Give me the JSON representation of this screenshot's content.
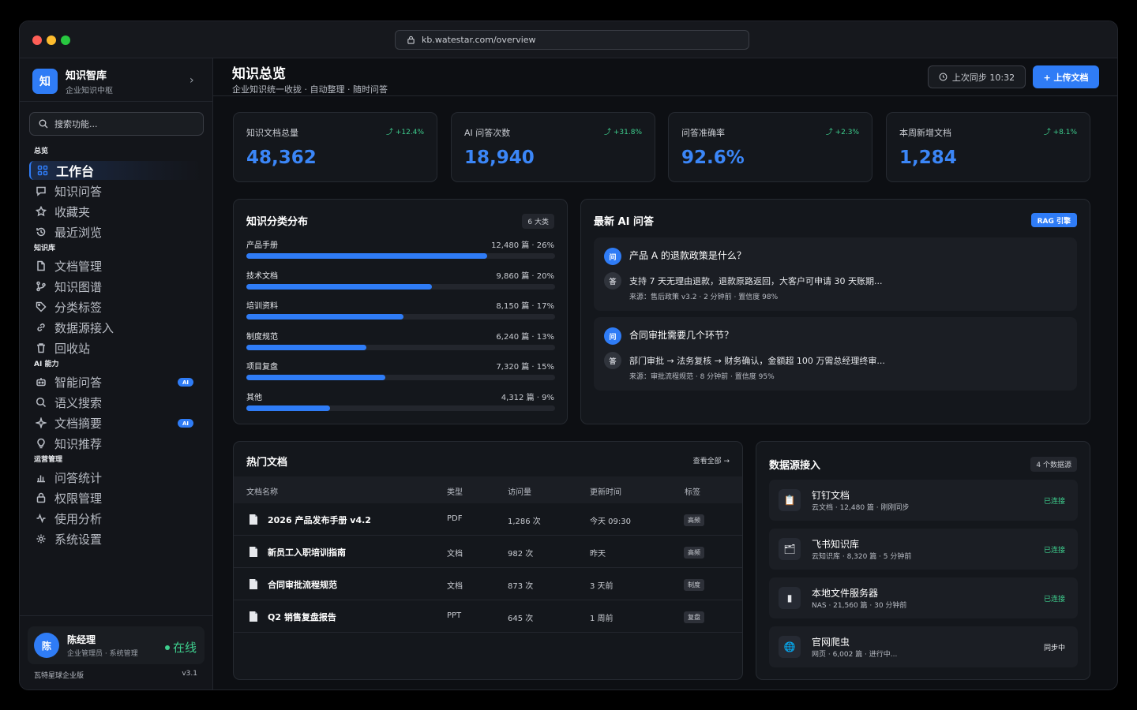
{
  "browser": {
    "url": "kb.watestar.com/overview"
  },
  "brand": {
    "logo": "知",
    "title": "知识智库",
    "subtitle": "企业知识中枢"
  },
  "search": {
    "placeholder": "搜索功能..."
  },
  "sections": {
    "overview": "总览",
    "kb": "知识库",
    "ai": "AI 能力",
    "ops": "运营管理"
  },
  "nav": [
    {
      "label": "工作台",
      "icon": "grid-icon"
    },
    {
      "label": "知识问答",
      "icon": "chat-icon"
    },
    {
      "label": "收藏夹",
      "icon": "star-icon"
    },
    {
      "label": "最近浏览",
      "icon": "history-icon"
    },
    {
      "label": "文档管理",
      "icon": "file-icon"
    },
    {
      "label": "知识图谱",
      "icon": "graph-icon"
    },
    {
      "label": "分类标签",
      "icon": "tag-icon"
    },
    {
      "label": "数据源接入",
      "icon": "link-icon"
    },
    {
      "label": "回收站",
      "icon": "trash-icon"
    },
    {
      "label": "智能问答",
      "icon": "robot-icon",
      "badge": "AI"
    },
    {
      "label": "语义搜索",
      "icon": "search-icon"
    },
    {
      "label": "文档摘要",
      "icon": "sparkle-icon",
      "badge": "AI"
    },
    {
      "label": "知识推荐",
      "icon": "bulb-icon"
    },
    {
      "label": "问答统计",
      "icon": "bar-chart-icon"
    },
    {
      "label": "权限管理",
      "icon": "lock-icon"
    },
    {
      "label": "使用分析",
      "icon": "activity-icon"
    },
    {
      "label": "系统设置",
      "icon": "gear-icon"
    }
  ],
  "user": {
    "avatar": "陈",
    "name": "陈经理",
    "role": "企业管理员 · 系统管理",
    "status": "在线"
  },
  "footer": {
    "edition": "瓦特星球企业版",
    "version": "v3.1"
  },
  "header": {
    "title": "知识总览",
    "subtitle": "企业知识统一收拢 · 自动整理 · 随时问答",
    "sync": "上次同步 10:32",
    "upload": "+ 上传文档"
  },
  "stats": [
    {
      "label": "知识文档总量",
      "delta": "+12.4%",
      "value": "48,362"
    },
    {
      "label": "AI 问答次数",
      "delta": "+31.8%",
      "value": "18,940"
    },
    {
      "label": "问答准确率",
      "delta": "+2.3%",
      "value": "92.6%"
    },
    {
      "label": "本周新增文档",
      "delta": "+8.1%",
      "value": "1,284"
    }
  ],
  "categories": {
    "title": "知识分类分布",
    "badge": "6 大类",
    "items": [
      {
        "name": "产品手册",
        "value": "12,480 篇 · 26%",
        "fraction": 0.78
      },
      {
        "name": "技术文档",
        "value": "9,860 篇 · 20%",
        "fraction": 0.6
      },
      {
        "name": "培训资料",
        "value": "8,150 篇 · 17%",
        "fraction": 0.51
      },
      {
        "name": "制度规范",
        "value": "6,240 篇 · 13%",
        "fraction": 0.39
      },
      {
        "name": "项目复盘",
        "value": "7,320 篇 · 15%",
        "fraction": 0.45
      },
      {
        "name": "其他",
        "value": "4,312 篇 · 9%",
        "fraction": 0.27
      }
    ]
  },
  "qa": {
    "title": "最新 AI 问答",
    "badge": "RAG 引擎",
    "q_label": "问",
    "a_label": "答",
    "items": [
      {
        "q": "产品 A 的退款政策是什么？",
        "a": "支持 7 天无理由退款，退款原路返回，大客户可申请 30 天账期...",
        "src": "来源：售后政策 v3.2 · 2 分钟前 · 置信度 98%"
      },
      {
        "q": "合同审批需要几个环节？",
        "a": "部门审批 → 法务复核 → 财务确认，金额超 100 万需总经理终审...",
        "src": "来源：审批流程规范 · 8 分钟前 · 置信度 95%"
      }
    ]
  },
  "docs": {
    "title": "热门文档",
    "view_all": "查看全部 →",
    "columns": [
      "文档名称",
      "类型",
      "访问量",
      "更新时间",
      "标签"
    ],
    "rows": [
      {
        "name": "2026 产品发布手册 v4.2",
        "type": "PDF",
        "views": "1,286 次",
        "updated": "今天 09:30",
        "tag": "高频"
      },
      {
        "name": "新员工入职培训指南",
        "type": "文档",
        "views": "982 次",
        "updated": "昨天",
        "tag": "高频"
      },
      {
        "name": "合同审批流程规范",
        "type": "文档",
        "views": "873 次",
        "updated": "3 天前",
        "tag": "制度"
      },
      {
        "name": "Q2 销售复盘报告",
        "type": "PPT",
        "views": "645 次",
        "updated": "1 周前",
        "tag": "复盘"
      }
    ]
  },
  "sources": {
    "title": "数据源接入",
    "badge": "4 个数据源",
    "items": [
      {
        "name": "钉钉文档",
        "meta": "云文档 · 12,480 篇 · 刚刚同步",
        "status": "已连接",
        "icon": "dingtalk-icon",
        "color": "#3ecf8e"
      },
      {
        "name": "飞书知识库",
        "meta": "云知识库 · 8,320 篇 · 5 分钟前",
        "status": "已连接",
        "icon": "feishu-icon",
        "color": "#3ecf8e"
      },
      {
        "name": "本地文件服务器",
        "meta": "NAS · 21,560 篇 · 30 分钟前",
        "status": "已连接",
        "icon": "server-icon",
        "color": "#3ecf8e"
      },
      {
        "name": "官网爬虫",
        "meta": "网页 · 6,002 篇 · 进行中...",
        "status": "同步中",
        "icon": "globe-icon",
        "color": "#e6e8ec"
      }
    ]
  }
}
